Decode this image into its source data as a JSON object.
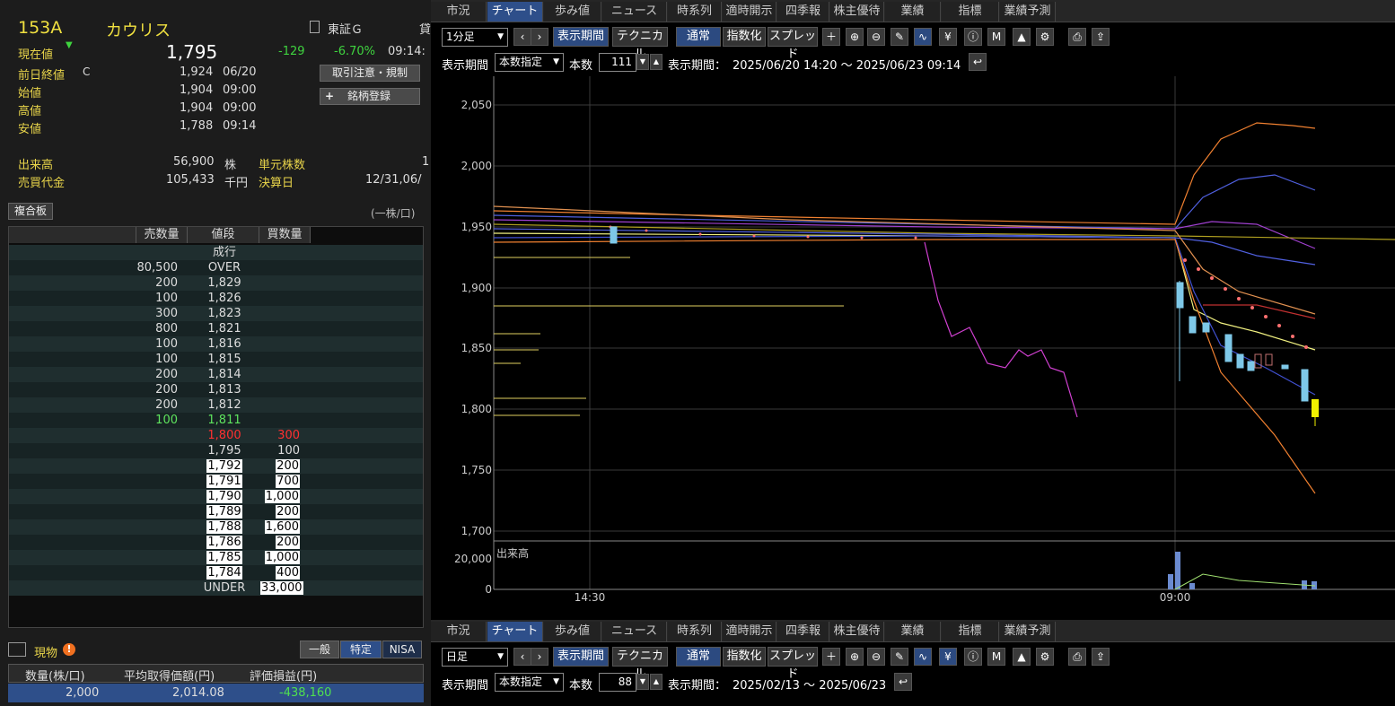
{
  "stock": {
    "code": "153A",
    "name": "カウリス",
    "market": "東証Ｇ",
    "market_suffix": "貸",
    "current_label": "現在値",
    "current_price": "1,795",
    "change": "-129",
    "change_pct": "-6.70%",
    "time": "09:14:"
  },
  "quote": [
    {
      "label": "前日終値",
      "flag": "C",
      "value": "1,924",
      "time": "06/20"
    },
    {
      "label": "始値",
      "value": "1,904",
      "time": "09:00"
    },
    {
      "label": "高値",
      "value": "1,904",
      "time": "09:00"
    },
    {
      "label": "安値",
      "value": "1,788",
      "time": "09:14"
    }
  ],
  "buttons": {
    "caution": "取引注意・規制",
    "register": "銘柄登録",
    "register_icon": "+"
  },
  "volume": {
    "label": "出来高",
    "value": "56,900",
    "unit": "株",
    "unit_label": "単元株数",
    "unit_value": "1"
  },
  "turnover": {
    "label": "売買代金",
    "value": "105,433",
    "unit": "千円",
    "settle_label": "決算日",
    "settle_value": "12/31,06/"
  },
  "board": {
    "title": "複合板",
    "unit": "(一株/口)",
    "headers": [
      "売数量",
      "値段",
      "買数量"
    ],
    "rows": [
      {
        "s": "",
        "p": "成行",
        "b": ""
      },
      {
        "s": "80,500",
        "p": "OVER",
        "b": ""
      },
      {
        "s": "200",
        "p": "1,829",
        "b": ""
      },
      {
        "s": "100",
        "p": "1,826",
        "b": ""
      },
      {
        "s": "300",
        "p": "1,823",
        "b": ""
      },
      {
        "s": "800",
        "p": "1,821",
        "b": ""
      },
      {
        "s": "100",
        "p": "1,816",
        "b": ""
      },
      {
        "s": "100",
        "p": "1,815",
        "b": ""
      },
      {
        "s": "200",
        "p": "1,814",
        "b": ""
      },
      {
        "s": "200",
        "p": "1,813",
        "b": ""
      },
      {
        "s": "200",
        "p": "1,812",
        "b": ""
      },
      {
        "s": "100",
        "p": "1,811",
        "b": ""
      },
      {
        "s": "",
        "p": "1,800",
        "b": "300"
      },
      {
        "s": "",
        "p": "1,795",
        "b": "100"
      },
      {
        "s": "",
        "p": "1,792",
        "b": "200"
      },
      {
        "s": "",
        "p": "1,791",
        "b": "700"
      },
      {
        "s": "",
        "p": "1,790",
        "b": "1,000"
      },
      {
        "s": "",
        "p": "1,789",
        "b": "200"
      },
      {
        "s": "",
        "p": "1,788",
        "b": "1,600"
      },
      {
        "s": "",
        "p": "1,786",
        "b": "200"
      },
      {
        "s": "",
        "p": "1,785",
        "b": "1,000"
      },
      {
        "s": "",
        "p": "1,784",
        "b": "400"
      },
      {
        "s": "",
        "p": "UNDER",
        "b": "33,000"
      }
    ]
  },
  "position": {
    "title": "現物",
    "warn": "!",
    "tabs": [
      "一般",
      "特定",
      "NISA"
    ],
    "headers": [
      "数量(株/口)",
      "平均取得価額(円)",
      "評価損益(円)"
    ],
    "qty": "2,000",
    "avg": "2,014.08",
    "pnl": "-438,160"
  },
  "tabs": [
    "市況",
    "チャート",
    "歩み値",
    "ニュース",
    "時系列",
    "適時開示",
    "四季報",
    "株主優待",
    "業績",
    "指標",
    "業績予測"
  ],
  "chart1": {
    "interval": "1分足",
    "period_btn": "表示期間",
    "tech_btn": "テクニカル",
    "normal": "通常",
    "index": "指数化",
    "spread": "スプレッド",
    "period_label": "表示期間",
    "period_mode": "本数指定",
    "count_label": "本数",
    "count": "111",
    "range_label": "表示期間：",
    "range": "2025/06/20 14:20 〜 2025/06/23 09:14",
    "y_ticks": [
      "2,050",
      "2,000",
      "1,950",
      "1,900",
      "1,850",
      "1,800",
      "1,750",
      "1,700"
    ],
    "vol_label": "出来高",
    "vol_ticks": [
      "20,000",
      "0"
    ],
    "x_ticks": [
      "14:30",
      "09:00"
    ]
  },
  "chart2": {
    "interval": "日足",
    "period_btn": "表示期間",
    "tech_btn": "テクニカル",
    "normal": "通常",
    "index": "指数化",
    "spread": "スプレッド",
    "period_label": "表示期間",
    "period_mode": "本数指定",
    "count_label": "本数",
    "count": "88",
    "range_label": "表示期間：",
    "range": "2025/02/13 〜 2025/06/23"
  },
  "icons": [
    "plus-icon",
    "zoom-in-icon",
    "zoom-out-icon",
    "pen-icon",
    "line-icon",
    "yen-icon",
    "info-icon",
    "my-icon",
    "mountain-icon",
    "wrench-icon",
    "print-icon",
    "export-icon"
  ],
  "colors": {
    "accent": "#2e4f8a",
    "up": "#f0e040",
    "down_candle": "#7ec8e8",
    "last_candle": "#f0f000",
    "sell": "#ffffff",
    "buy_low": "#ff3030",
    "ask_best": "#5ee35e",
    "pnl": "#4fe04f"
  }
}
